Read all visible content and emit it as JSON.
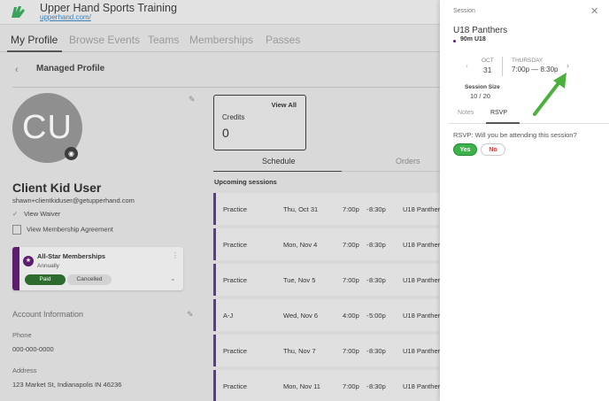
{
  "header": {
    "brand_title": "Upper Hand Sports Training",
    "brand_url": "upperhand.com/"
  },
  "nav": {
    "tabs": [
      "My Profile",
      "Browse Events",
      "Teams",
      "Memberships",
      "Passes"
    ]
  },
  "profile": {
    "section_title": "Managed Profile",
    "avatar_initials": "CU",
    "name": "Client Kid User",
    "email": "shawn+clientkiduser@getupperhand.com",
    "view_waiver": "View Waiver",
    "view_agreement": "View Membership Agreement"
  },
  "membership": {
    "name": "All-Star Memberships",
    "interval": "Annually",
    "paid_label": "Paid",
    "cancelled_label": "Cancelled",
    "colors": {
      "stripe": "#5e1c6e",
      "paid": "#2e6b2e"
    }
  },
  "account": {
    "title": "Account Information",
    "phone_label": "Phone",
    "phone_value": "000-000-0000",
    "address_label": "Address",
    "address_value": "123 Market St, Indianapolis IN 46236"
  },
  "credits": {
    "view_all": "View All",
    "label": "Credits",
    "value": "0"
  },
  "schedule": {
    "tab_schedule": "Schedule",
    "tab_orders": "Orders",
    "upcoming_label": "Upcoming sessions",
    "rows": [
      {
        "type": "Practice",
        "date": "Thu, Oct 31",
        "start": "7:00p",
        "end": "8:30p",
        "team": "U18 Panthers"
      },
      {
        "type": "Practice",
        "date": "Mon, Nov 4",
        "start": "7:00p",
        "end": "8:30p",
        "team": "U18 Panthers"
      },
      {
        "type": "Practice",
        "date": "Tue, Nov 5",
        "start": "7:00p",
        "end": "8:30p",
        "team": "U18 Panthers"
      },
      {
        "type": "A-J",
        "date": "Wed, Nov 6",
        "start": "4:00p",
        "end": "5:00p",
        "team": "U18 Panthers"
      },
      {
        "type": "Practice",
        "date": "Thu, Nov 7",
        "start": "7:00p",
        "end": "8:30p",
        "team": "U18 Panthers"
      },
      {
        "type": "Practice",
        "date": "Mon, Nov 11",
        "start": "7:00p",
        "end": "8:30p",
        "team": "U18 Panthers"
      }
    ]
  },
  "drawer": {
    "label": "Session",
    "title": "U18 Panthers",
    "subtitle": "90m U18",
    "month": "OCT",
    "day": "31",
    "dow": "THURSDAY",
    "time": "7:00p — 8:30p",
    "size_label": "Session Size",
    "size_value": "10 / 20",
    "tab_notes": "Notes",
    "tab_rsvp": "RSVP",
    "question": "RSVP: Will you be attending this session?",
    "yes_label": "Yes",
    "no_label": "No",
    "colors": {
      "yes": "#3cb34a",
      "no": "#d23a3a",
      "arrow": "#4caf3e"
    }
  }
}
